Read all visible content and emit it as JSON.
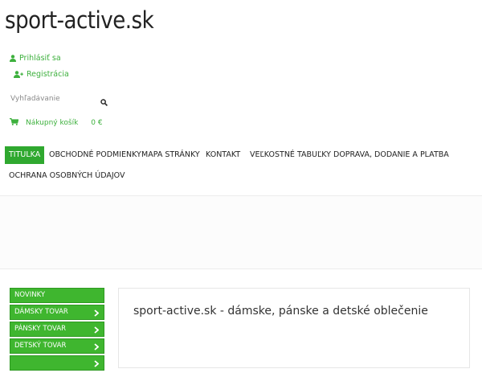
{
  "header": {
    "site_title": "sport-active.sk",
    "login_label": "Prihlásiť sa",
    "register_label": "Registrácia",
    "search": {
      "placeholder": "Vyhľadávanie"
    },
    "cart": {
      "label": "Nákupný košík",
      "price": "0 €"
    }
  },
  "nav": {
    "items": [
      {
        "label": "TITULKA",
        "active": true
      },
      {
        "label": "OBCHODNÉ PODMIENKY"
      },
      {
        "label": "MAPA STRÁNKY"
      },
      {
        "label": "KONTAKT"
      },
      {
        "label": "VEĽKOSTNÉ TABUĽKY"
      },
      {
        "label": "DOPRAVA, DODANIE A PLATBA"
      },
      {
        "label": "OCHRANA OSOBNÝCH ÚDAJOV"
      }
    ]
  },
  "sidebar": {
    "items": [
      {
        "label": "NOVINKY"
      },
      {
        "label": "DÁMSKY TOVAR"
      },
      {
        "label": "PÁNSKY TOVAR"
      },
      {
        "label": "DETSKÝ TOVAR"
      }
    ]
  },
  "main": {
    "heading": "sport-active.sk - dámske, pánske a detské oblečenie"
  },
  "colors": {
    "accent": "#3db03d",
    "nav_active_bg": "#2fa82f",
    "sidebar_bg": "#3fb62f"
  }
}
